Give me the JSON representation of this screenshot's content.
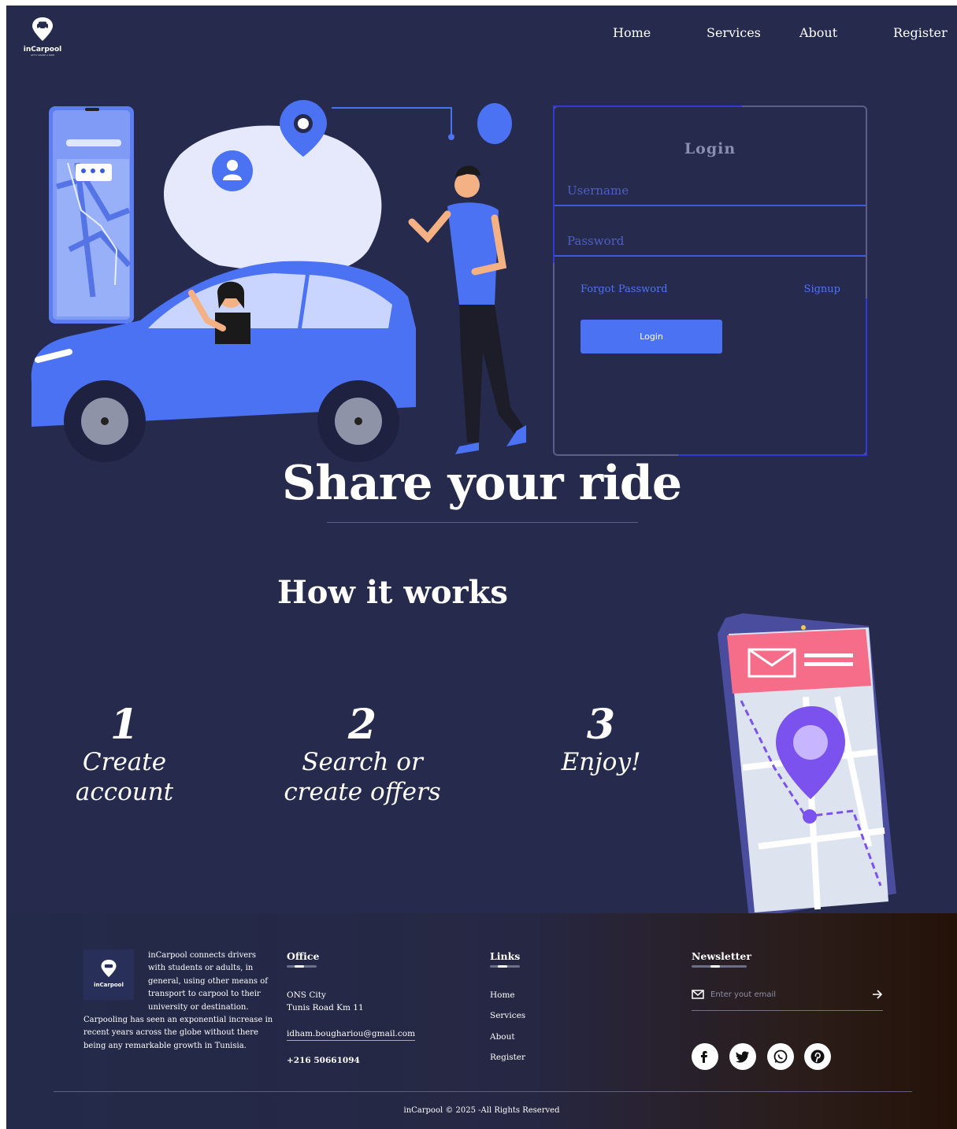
{
  "brand": {
    "name": "inCarpool",
    "tagline": "LET'S SHARE A RIDE"
  },
  "nav": {
    "items": [
      "Home",
      "Services",
      "About",
      "Register"
    ]
  },
  "login": {
    "title": "Login",
    "username_placeholder": "Username",
    "password_placeholder": "Password",
    "forgot_label": "Forgot Password",
    "signup_label": "Signup",
    "button_label": "Login"
  },
  "hero": {
    "headline": "Share your ride"
  },
  "how": {
    "title": "How it works",
    "steps": [
      {
        "num": "1",
        "label": "Create account"
      },
      {
        "num": "2",
        "label": "Search or create offers"
      },
      {
        "num": "3",
        "label": "Enjoy!"
      }
    ]
  },
  "footer": {
    "about": "inCarpool connects drivers with students or adults, in general, using other means of transport to carpool to their university or destination. Carpooling has seen an exponential increase in recent years across the globe without there being any remarkable growth in Tunisia.",
    "office": {
      "title": "Office",
      "line1": "ONS City",
      "line2": "Tunis Road Km 11",
      "email": "idham.boughariou@gmail.com",
      "phone": "+216 50661094"
    },
    "links": {
      "title": "Links",
      "items": [
        "Home",
        "Services",
        "About",
        "Register"
      ]
    },
    "newsletter": {
      "title": "Newsletter",
      "placeholder": "Enter yout email"
    },
    "social": [
      "facebook-icon",
      "twitter-icon",
      "whatsapp-icon",
      "pinterest-icon"
    ],
    "copyright": "inCarpool © 2025 -All Rights Reserved"
  },
  "colors": {
    "background": "#262a4d",
    "accent": "#4b72f3",
    "field_border": "#3e59e0",
    "phone_header": "#f56d88",
    "pin": "#7b52ee"
  }
}
